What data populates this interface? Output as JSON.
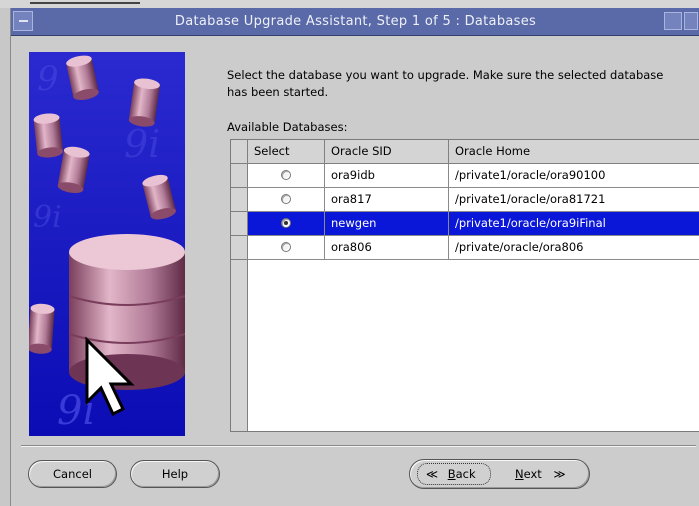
{
  "window": {
    "title": "Database Upgrade Assistant, Step 1 of 5 : Databases"
  },
  "content": {
    "description": "Select the database you want to upgrade. Make sure the selected database has been started.",
    "available_label": "Available Databases:"
  },
  "table": {
    "columns": [
      "Select",
      "Oracle SID",
      "Oracle Home"
    ],
    "rows": [
      {
        "sid": "ora9idb",
        "home": "/private1/oracle/ora90100",
        "selected": false
      },
      {
        "sid": "ora817",
        "home": "/private1/oracle/ora81721",
        "selected": false
      },
      {
        "sid": "newgen",
        "home": "/private1/oracle/ora9iFinal",
        "selected": true
      },
      {
        "sid": "ora806",
        "home": "/private/oracle/ora806",
        "selected": false
      }
    ]
  },
  "buttons": {
    "cancel": "Cancel",
    "help": "Help",
    "back_first": "B",
    "back_rest": "ack",
    "back_arrow": "≪",
    "next_first": "N",
    "next_rest": "ext",
    "next_arrow": "≫"
  },
  "image": {
    "watermark": "9i"
  },
  "colors": {
    "titlebar": "#5a6aa8",
    "selection": "#0a16d8",
    "side_background": "#1818c4",
    "cylinder": "#b07a96"
  }
}
